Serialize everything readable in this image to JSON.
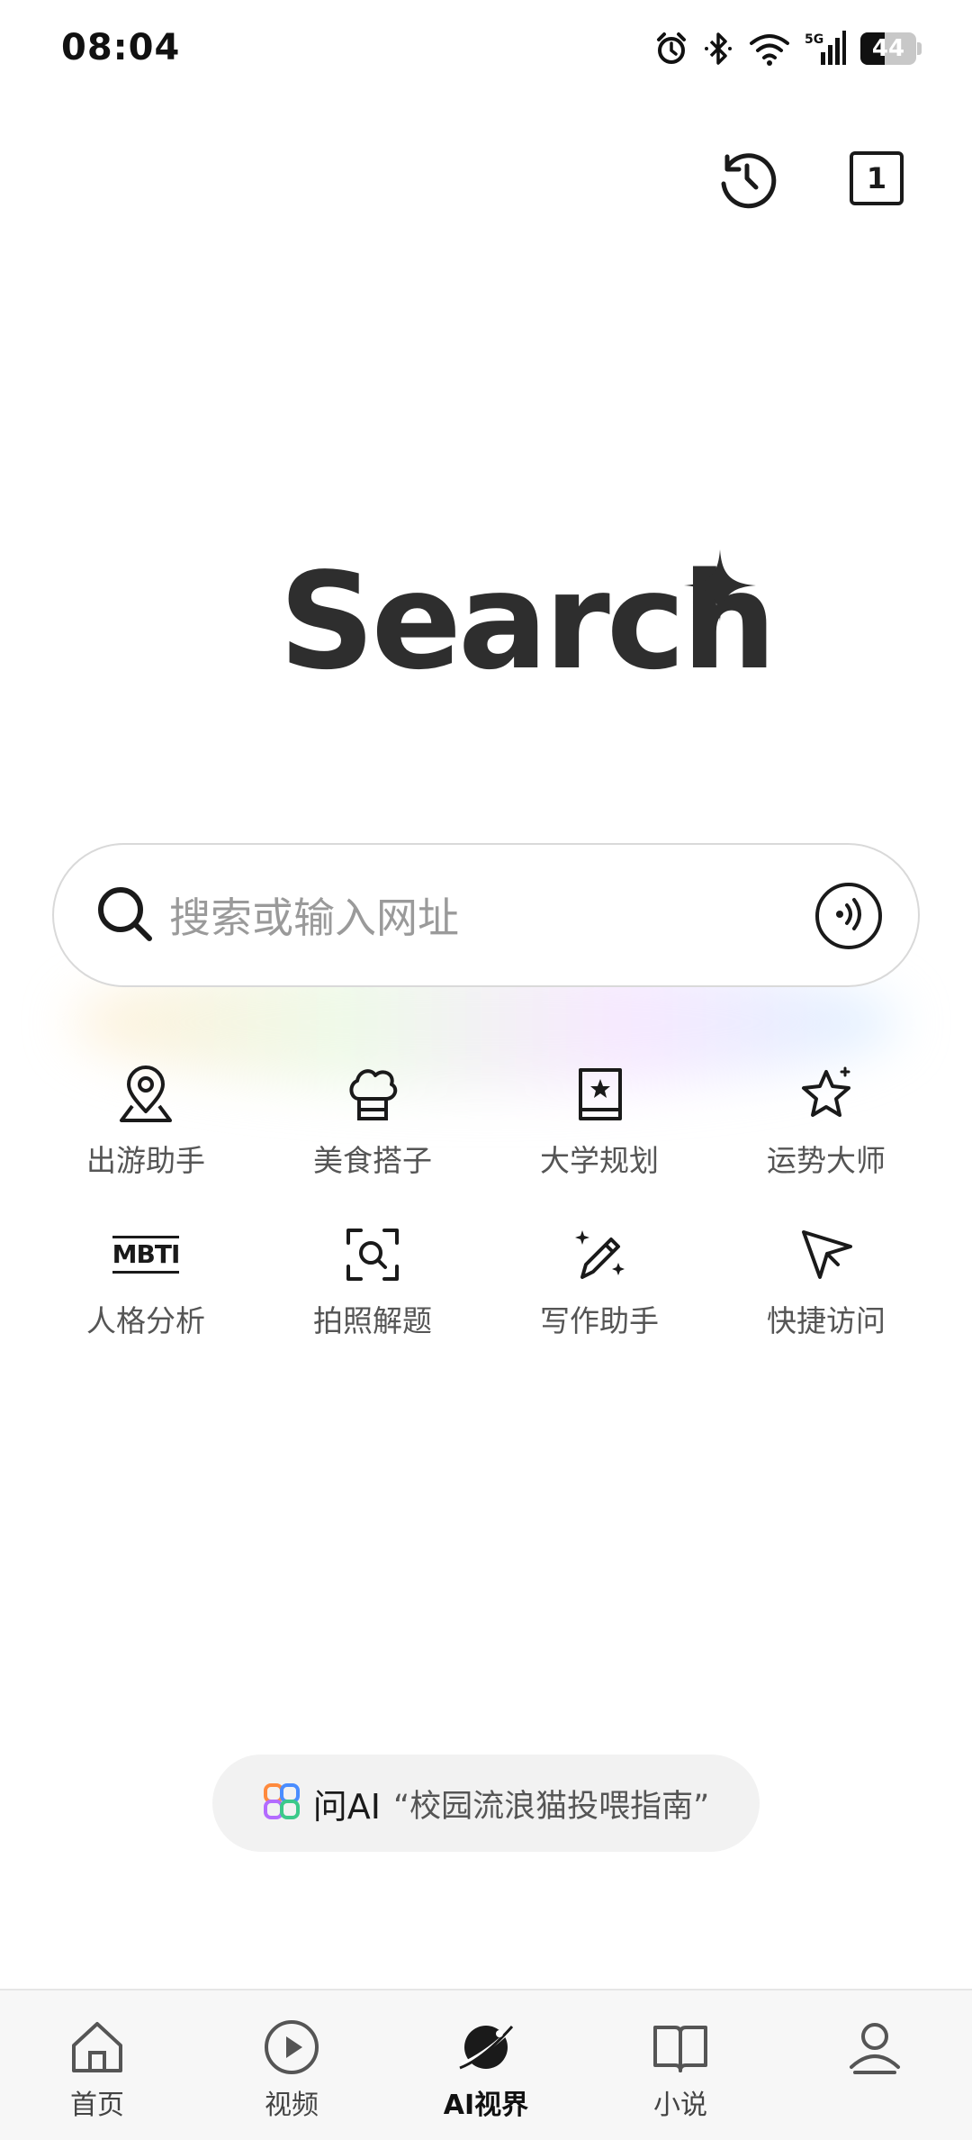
{
  "status_bar": {
    "time": "08:04",
    "network": "5G",
    "battery_level": "44",
    "icons": [
      "alarm-icon",
      "bluetooth-icon",
      "wifi-icon",
      "signal-icon",
      "battery-icon"
    ]
  },
  "top_actions": {
    "history_icon": "history-clock-icon",
    "tab_count": "1"
  },
  "logo": {
    "text": "Search",
    "accent_icon": "sparkle-plus-icon"
  },
  "search": {
    "placeholder": "搜索或输入网址",
    "value": "",
    "voice_icon": "voice-input-icon"
  },
  "shortcuts": [
    {
      "label": "出游助手",
      "icon": "map-pin-icon"
    },
    {
      "label": "美食搭子",
      "icon": "chef-hat-icon"
    },
    {
      "label": "大学规划",
      "icon": "star-book-icon"
    },
    {
      "label": "运势大师",
      "icon": "sparkle-star-icon"
    },
    {
      "label": "人格分析",
      "icon": "mbti-icon",
      "icon_text": "MBTI"
    },
    {
      "label": "拍照解题",
      "icon": "scan-search-icon"
    },
    {
      "label": "写作助手",
      "icon": "magic-pen-icon"
    },
    {
      "label": "快捷访问",
      "icon": "send-arrow-icon"
    }
  ],
  "ask_ai": {
    "prefix": "问AI",
    "text": "“校园流浪猫投喂指南”"
  },
  "bottom_nav": [
    {
      "label": "首页",
      "icon": "home-icon"
    },
    {
      "label": "视频",
      "icon": "play-circle-icon"
    },
    {
      "label": "AI视界",
      "icon": "planet-icon",
      "active": true
    },
    {
      "label": "小说",
      "icon": "book-icon"
    },
    {
      "label": "",
      "icon": "profile-icon"
    }
  ],
  "colors": {
    "text_primary": "#1a1a1a",
    "text_secondary": "#555555",
    "placeholder": "#9a9a9a",
    "search_border": "#d9d9d9",
    "nav_bg": "#f7f7f7"
  }
}
